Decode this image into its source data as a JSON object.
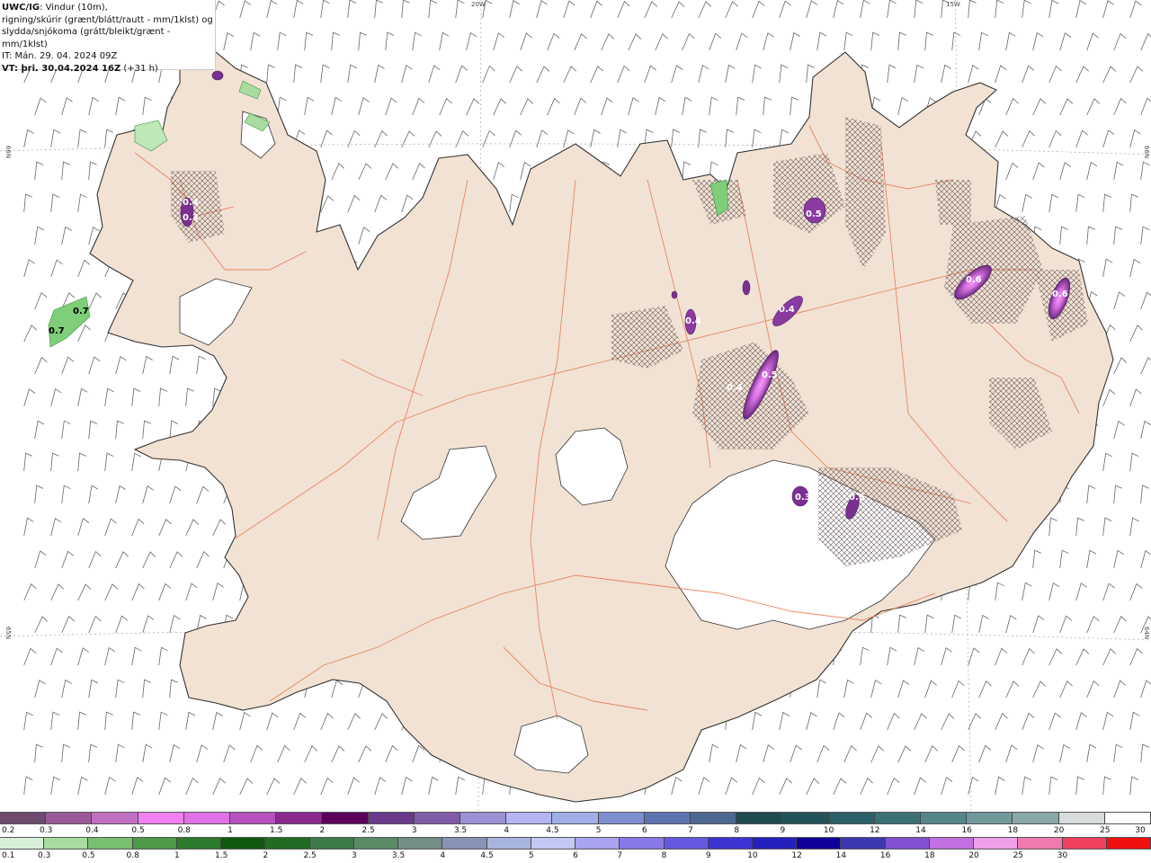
{
  "header": {
    "product": "UWC/IG",
    "line1_rest": ": Vindur (10m),",
    "line2": "rigning/skúrir (grænt/blátt/rautt - mm/1klst) og",
    "line3": "slydda/snjókoma (grátt/bleikt/grænt - mm/1klst)",
    "line4": "IT: Mán. 29. 04. 2024 09Z",
    "vt_label": "VT: þri. 30.04.2024 16Z",
    "vt_offset": " (+31 h)"
  },
  "grid_labels": {
    "lon1": "20W",
    "lon2": "15W",
    "lat_left_top": "66N",
    "lat_left_bottom": "65N",
    "lat_right_top": "66N",
    "lat_right_bottom": "64N"
  },
  "map_labels": [
    "0.7",
    "0.7",
    "0.5",
    "0.5",
    "0.4",
    "0.4",
    "0.6",
    "0.6",
    "0.3",
    "0.4",
    "0.3",
    "0.4",
    "0.5"
  ],
  "colors": {
    "land": "#f1e2d4",
    "coast": "#333333",
    "roads": "#e8744a",
    "glacier": "#ffffff",
    "sea": "#ffffff",
    "wind_barb": "#555555",
    "snow_purple": "#7b2f9a",
    "snow_pink": "#e267f0",
    "rain_green": "#55b855",
    "hatch": "#6b5a5a"
  },
  "legend_top": {
    "colors": [
      "#6e4a6e",
      "#9a5a9a",
      "#c26ec2",
      "#f280f2",
      "#e070e6",
      "#b850c0",
      "#8a2a8e",
      "#5c005c",
      "#6a3a8a",
      "#7e5ca8",
      "#9a90d6",
      "#b4b4f4",
      "#a0aee8",
      "#7c8ed0",
      "#5c74b0",
      "#4c6890",
      "#1e4a50",
      "#24525a",
      "#2c6068",
      "#3a7076",
      "#56868a",
      "#70989a",
      "#8aa8a8",
      "#d8dcdc",
      "#ffffff"
    ],
    "ticks": [
      "0.2",
      "0.3",
      "0.4",
      "0.5",
      "0.8",
      "1",
      "1.5",
      "2",
      "2.5",
      "3",
      "3.5",
      "4",
      "4.5",
      "5",
      "6",
      "7",
      "8",
      "9",
      "10",
      "12",
      "14",
      "16",
      "18",
      "20",
      "25",
      "30"
    ]
  },
  "legend_bottom": {
    "colors": [
      "#d8f0d8",
      "#a8dca0",
      "#78c070",
      "#4c9a48",
      "#2e7a2c",
      "#105a10",
      "#226b22",
      "#3a7a48",
      "#5a8a66",
      "#748e88",
      "#8894b4",
      "#a8b4e0",
      "#c4c8f4",
      "#a8a4f0",
      "#8878e8",
      "#6458e0",
      "#3c34d0",
      "#2420c0",
      "#10009a",
      "#3c38b0",
      "#8050d0",
      "#c070e0",
      "#f0a0e8",
      "#f07ab0",
      "#f04060",
      "#f01010"
    ],
    "ticks": [
      "0.1",
      "0.3",
      "0.5",
      "0.8",
      "1",
      "1.5",
      "2",
      "2.5",
      "3",
      "3.5",
      "4",
      "4.5",
      "5",
      "6",
      "7",
      "8",
      "9",
      "10",
      "12",
      "14",
      "16",
      "18",
      "20",
      "25",
      "30"
    ]
  }
}
